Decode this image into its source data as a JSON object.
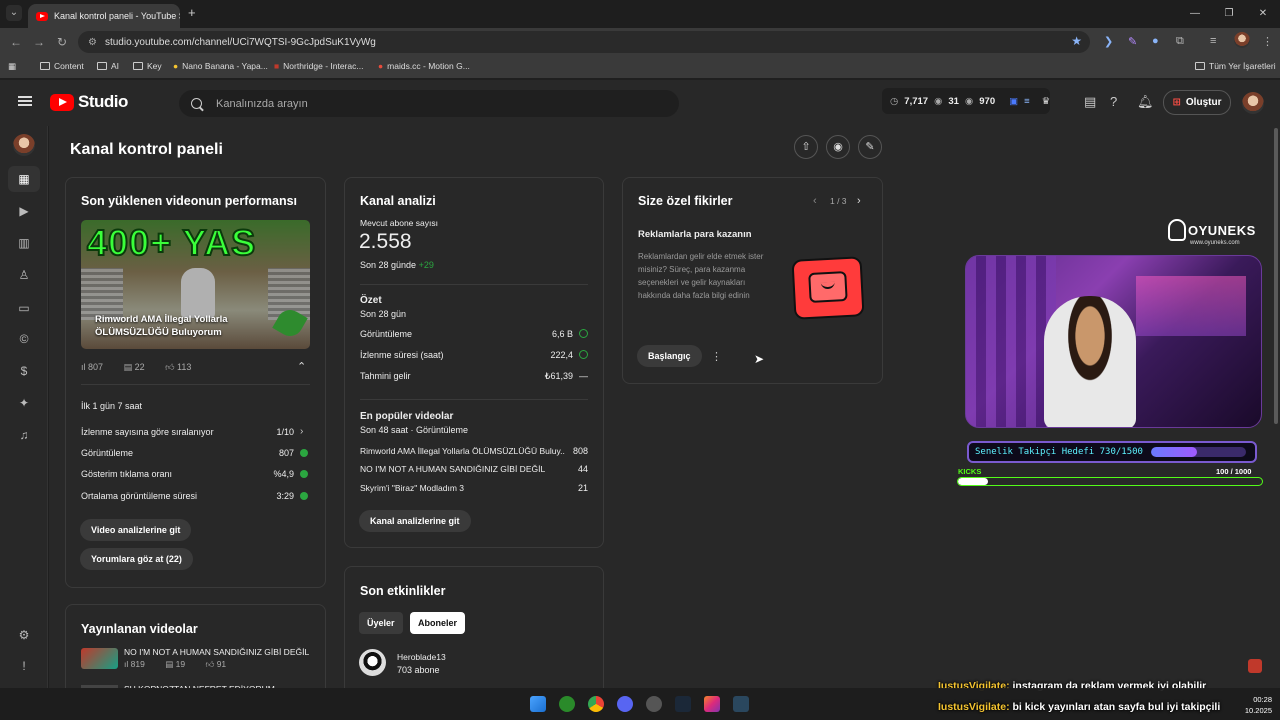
{
  "browser": {
    "tab_title": "Kanal kontrol paneli - YouTube Studio",
    "tab_close": "✕",
    "new_tab": "+",
    "url": "studio.youtube.com/channel/UCi7WQTSI-9GcJpdSuK1VyWg",
    "bookmarks": [
      "Content",
      "AI",
      "Key",
      "Nano Banana - Yapa...",
      "Northridge - Interac...",
      "maids.cc - Motion G..."
    ],
    "all_bookmarks": "Tüm Yer İşaretleri"
  },
  "header": {
    "logo_text": "Studio",
    "search_placeholder": "Kanalınızda arayın",
    "stat_views": "7,717",
    "stat_eye": "31",
    "stat_watch": "970",
    "create_label": "Oluştur"
  },
  "page": {
    "title": "Kanal kontrol paneli"
  },
  "latest_video": {
    "card_title": "Son yüklenen videonun performansı",
    "thumb_big": "400+ YAS",
    "thumb_caption": "Rimworld AMA İllegal Yollarla ÖLÜMSÜZLÜĞÜ Buluyorum",
    "views": "807",
    "comments": "22",
    "likes": "113",
    "period": "İlk 1 gün 7 saat",
    "rows": [
      {
        "label": "İzlenme sayısına göre sıralanıyor",
        "value": "1/10"
      },
      {
        "label": "Görüntüleme",
        "value": "807"
      },
      {
        "label": "Gösterim tıklama oranı",
        "value": "%4,9"
      },
      {
        "label": "Ortalama görüntüleme süresi",
        "value": "3:29"
      }
    ],
    "btn_analytics": "Video analizlerine git",
    "btn_comments": "Yorumlara göz at (22)"
  },
  "published": {
    "card_title": "Yayınlanan videolar",
    "video_title": "NO I'M NOT A HUMAN SANDIĞINIZ GİBİ DEĞİL",
    "views": "819",
    "comments": "19",
    "likes": "91",
    "next_title": "ŞU KOPNOZTAN NEFRET EDİYORUM #gaming"
  },
  "analytics": {
    "card_title": "Kanal analizi",
    "subs_label": "Mevcut abone sayısı",
    "subs_value": "2.558",
    "subs_delta_label": "Son 28 günde",
    "subs_delta": "+29",
    "summary_title": "Özet",
    "summary_period": "Son 28 gün",
    "summary_rows": [
      {
        "label": "Görüntüleme",
        "value": "6,6 B"
      },
      {
        "label": "İzlenme süresi (saat)",
        "value": "222,4"
      },
      {
        "label": "Tahmini gelir",
        "value": "₺61,39"
      }
    ],
    "summary_dash": "—",
    "popular_title": "En popüler videolar",
    "popular_period": "Son 48 saat · Görüntüleme",
    "popular_rows": [
      {
        "label": "Rimworld AMA İllegal Yollarla ÖLÜMSÜZLÜĞÜ Buluy...",
        "value": "808"
      },
      {
        "label": "NO I'M NOT A HUMAN SANDIĞINIZ GİBİ DEĞİL",
        "value": "44"
      },
      {
        "label": "Skyrim'i \"Biraz\" Modladım 3",
        "value": "21"
      }
    ],
    "btn": "Kanal analizlerine git"
  },
  "activity": {
    "card_title": "Son etkinlikler",
    "tab_members": "Üyeler",
    "tab_subs": "Aboneler",
    "user_name": "Heroblade13",
    "user_subs": "703 abone"
  },
  "ideas": {
    "card_title": "Size özel fikirler",
    "pager": "1 / 3",
    "heading": "Reklamlarla para kazanın",
    "body": "Reklamlardan gelir elde etmek ister misiniz? Süreç, para kazanma seçenekleri ve gelir kaynakları hakkında daha fazla bilgi edinin",
    "btn": "Başlangıç"
  },
  "overlay": {
    "logo": "OYUNEKS",
    "logo_sub": "www.oyuneks.com",
    "goal_text": "Senelik Takipçi Hedefi 730/1500",
    "goal_progress": 0.487,
    "kicks_label": "KICKS",
    "kicks_value": "100  / 1000",
    "kicks_progress": 0.1
  },
  "chat": [
    {
      "user": "IustusVigilate:",
      "msg": "instagram da reklam vermek iyi olabilir"
    },
    {
      "user": "IustusVigilate:",
      "msg": "bi kick yayınları atan sayfa bul iyi takipçili"
    }
  ],
  "taskbar": {
    "time": "00:28",
    "date": "10.2025"
  },
  "colors": {
    "accent_red": "#ff0000",
    "success_green": "#2ba640",
    "kick_green": "#53fc18",
    "goal_cyan": "#5df2ff"
  }
}
